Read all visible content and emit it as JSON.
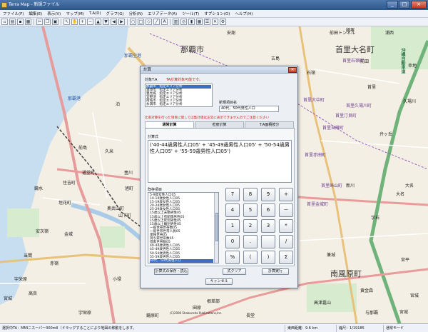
{
  "window": {
    "title": "Terra Map - 新規ファイル",
    "min": "_",
    "max": "□",
    "close": "×"
  },
  "menu": [
    "ファイル(F)",
    "編集(E)",
    "表示(V)",
    "マップ(M)",
    "T.A(D)",
    "グラフ(G)",
    "分析(N)",
    "エリアデータ(A)",
    "ツール(T)",
    "オプション(O)",
    "ヘルプ(H)"
  ],
  "map_labels": [
    {
      "text": "那覇市",
      "cls": "big"
    },
    {
      "text": "首里大名町",
      "cls": "big"
    },
    {
      "text": "南風原町",
      "cls": "big"
    },
    {
      "text": "首里石嶺町",
      "cls": "purple"
    },
    {
      "text": "首里当蔵町",
      "cls": "purple"
    },
    {
      "text": "首里崎山町",
      "cls": "purple"
    },
    {
      "text": "首里赤田町",
      "cls": "purple"
    },
    {
      "text": "首里汀良町",
      "cls": "purple"
    },
    {
      "text": "首里大中町",
      "cls": "purple"
    },
    {
      "text": "首里久場川町",
      "cls": "purple"
    },
    {
      "text": "首里金城町",
      "cls": "purple"
    },
    {
      "text": "前田トンネル",
      "cls": ""
    },
    {
      "text": "沖縄自動車道",
      "cls": "green"
    },
    {
      "text": "那覇空港",
      "cls": "blue"
    },
    {
      "text": "那覇港",
      "cls": "blue"
    },
    {
      "text": "安謝",
      "cls": ""
    },
    {
      "text": "古島",
      "cls": ""
    },
    {
      "text": "大名",
      "cls": ""
    },
    {
      "text": "幸地",
      "cls": ""
    },
    {
      "text": "久場川",
      "cls": ""
    },
    {
      "text": "弁ヶ岳",
      "cls": ""
    },
    {
      "text": "泊",
      "cls": ""
    },
    {
      "text": "前島",
      "cls": ""
    },
    {
      "text": "久米",
      "cls": ""
    },
    {
      "text": "通堂町",
      "cls": ""
    },
    {
      "text": "住吉町",
      "cls": ""
    },
    {
      "text": "壺川",
      "cls": ""
    },
    {
      "text": "旭町",
      "cls": ""
    },
    {
      "text": "奥武山町",
      "cls": ""
    },
    {
      "text": "垣花町",
      "cls": ""
    },
    {
      "text": "金城",
      "cls": ""
    },
    {
      "text": "安次嶺",
      "cls": ""
    },
    {
      "text": "鏡水",
      "cls": ""
    },
    {
      "text": "当間",
      "cls": ""
    },
    {
      "text": "赤嶺",
      "cls": ""
    },
    {
      "text": "高良",
      "cls": ""
    },
    {
      "text": "宮城",
      "cls": ""
    },
    {
      "text": "宇栄原",
      "cls": ""
    },
    {
      "text": "小禄",
      "cls": ""
    },
    {
      "text": "山下町",
      "cls": ""
    },
    {
      "text": "田原",
      "cls": ""
    },
    {
      "text": "根差部",
      "cls": ""
    },
    {
      "text": "長堂",
      "cls": ""
    },
    {
      "text": "高津嘉山",
      "cls": ""
    },
    {
      "text": "大名",
      "cls": ""
    },
    {
      "text": "宮平",
      "cls": ""
    },
    {
      "text": "新川",
      "cls": ""
    },
    {
      "text": "兼城",
      "cls": ""
    },
    {
      "text": "与那覇",
      "cls": ""
    },
    {
      "text": "宮城",
      "cls": ""
    },
    {
      "text": "黄金森",
      "cls": ""
    },
    {
      "text": "石嶺",
      "cls": ""
    },
    {
      "text": "首里",
      "cls": ""
    },
    {
      "text": "経塚",
      "cls": ""
    },
    {
      "text": "浦西",
      "cls": ""
    },
    {
      "text": "前田",
      "cls": ""
    },
    {
      "text": "字石",
      "cls": ""
    },
    {
      "text": "鏡原町",
      "cls": ""
    },
    {
      "text": "宇栄原",
      "cls": ""
    },
    {
      "text": "宮城",
      "cls": ""
    }
  ],
  "dialog": {
    "title": "計算",
    "close": "×",
    "target_label": "対象T.A",
    "target_note": "TA計算対象可能です。",
    "target_items": [
      "那覇市　指定エリア分析",
      "浦添市　指定エリア分析",
      "豊見城　指定エリア分析",
      "宜野湾　指定エリア分析",
      "南城市　指定エリア分析",
      "糸満市　指定エリア分析"
    ],
    "new_item_label": "新規項目名",
    "new_item_value": "40代、50代男性人口",
    "warning": "比率計算を行った項目に関しては集計値は正常に表示できませんのでご注意ください",
    "tabs": [
      "通常計算",
      "密度計算",
      "T.A面積按分"
    ],
    "formula_label": "計算式",
    "formula_text": "('40-44歳男性人口05' + '45-49歳男性人口05' + '50-54歳男性人口05' + '55-59歳男性人口05')",
    "items_label": "既存項目",
    "items": [
      "5-9歳女性人口05",
      "10-14歳女性人口05",
      "15-19歳女性人口05",
      "20-24歳女性人口05",
      "25-29歳女性人口05",
      "15歳以上未婚男性05",
      "15歳以上有配偶男性05",
      "15歳以上死別男性05",
      "15歳以上離別男性05",
      "一般世帯世帯数05",
      "一般世帯世帯人員05",
      "単独世帯05",
      "持ち家世帯数05",
      "借家世帯数05",
      "40-44歳男性人口05",
      "45-49歳男性人口05",
      "50-54歳男性人口05",
      "55-59歳男性人口05",
      "40代、50代男性人口"
    ],
    "keys": [
      "7",
      "8",
      "9",
      "+",
      "4",
      "5",
      "6",
      "－",
      "1",
      "2",
      "3",
      "*",
      "0",
      ".",
      "",
      "/",
      "%",
      "(",
      ")",
      "Σ"
    ],
    "save_btn": "計算式の保存・読込",
    "clear_btn": "式クリア",
    "calc_btn": "計算実行",
    "cancel_btn": "キャンセル"
  },
  "copyright": "(C)2006 Shobunsha Publications,Inc.",
  "status": {
    "hint": "選択中TA：MMIニスーパー300mII（ドラッグすることにより地図の移動をします。",
    "direction": "東西距離：9.6 km",
    "scale": "縮尺：1/19185",
    "mode": "通常モード"
  }
}
